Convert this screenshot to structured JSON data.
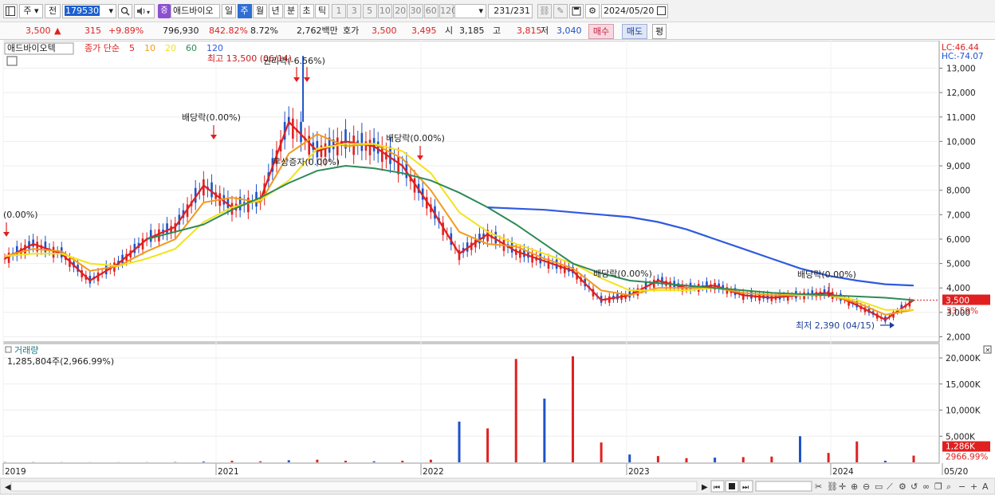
{
  "toolbar": {
    "type_label": "주",
    "compare_label": "전",
    "stock_code": "179530",
    "badge": "증",
    "stock_name": "애드바이오",
    "periods": [
      "일",
      "주",
      "월",
      "년",
      "분",
      "초",
      "틱"
    ],
    "active_period": "주",
    "intervals": [
      "1",
      "3",
      "5",
      "10",
      "20",
      "30",
      "60",
      "120"
    ],
    "count_value": "231",
    "count_total": "/231",
    "date": "2024/05/20"
  },
  "info": {
    "price": "3,500",
    "arrow": "▲",
    "change": "315",
    "change_pct": "+9.89%",
    "volume": "796,930",
    "volume_ratio": "842.82%",
    "turnover": "8.72%",
    "amount": "2,762백만",
    "quote_label": "호가",
    "ask": "3,500",
    "bid": "3,495",
    "open_label": "시",
    "open": "3,185",
    "high_label": "고",
    "high": "3,815",
    "low_label": "저",
    "low": "3,040",
    "buy_label": "매수",
    "sell_label": "매도",
    "eval_label": "평"
  },
  "price_panel": {
    "stock_label": "애드바이오텍",
    "ma_title": "종가 단순",
    "ma_periods": [
      "5",
      "10",
      "20",
      "60",
      "120"
    ],
    "ma_colors": [
      "#e02020",
      "#f29a1c",
      "#f2e31c",
      "#2e8a57",
      "#2f5ae0"
    ],
    "lc_label": "LC:46.44",
    "hc_label": "HC:-74.07",
    "y_ticks": [
      "13,000",
      "12,000",
      "11,000",
      "10,000",
      "9,000",
      "8,000",
      "7,000",
      "6,000",
      "5,000",
      "4,000",
      "3,000",
      "2,000"
    ],
    "current_price_badge": "3,500",
    "current_pct": "33.59%",
    "annotations": {
      "high": "최고 13,500 (06/14)",
      "rights": "권리락(-6.56%)",
      "div_2021": "배당락(0.00%)",
      "bonus": "무상증자(0.00%)",
      "div_2022": "배당락(0.00%)",
      "left": "(0.00%)",
      "div_2023a": "배당락(0.00%)",
      "div_2023b": "배당락(0.00%)",
      "low": "최저 2,390 (04/15)"
    }
  },
  "volume_panel": {
    "title": "거래량",
    "value_label": "1,285,804주(2,966.99%)",
    "y_ticks": [
      "20,000K",
      "15,000K",
      "10,000K",
      "5,000K"
    ],
    "current_badge": "1,286K",
    "current_pct": "2966.99%"
  },
  "x_axis": {
    "labels": [
      "2019",
      "2021",
      "2022",
      "2023",
      "2024",
      "05/20"
    ]
  },
  "chart_data": {
    "type": "candlestick",
    "title": "애드바이오텍",
    "period": "weekly",
    "x": [
      "2019",
      "2021",
      "2022",
      "2023",
      "2024",
      "05/20"
    ],
    "close_series": [
      {
        "name": "5",
        "values": [
          5200,
          5800,
          5400,
          4300,
          5000,
          6000,
          6500,
          8200,
          7300,
          7600,
          10800,
          9600,
          10000,
          9800,
          9000,
          7300,
          5400,
          6200,
          5500,
          5100,
          4700,
          3500,
          3700,
          4300,
          4000,
          4100,
          3700,
          3600,
          3700,
          3800,
          3300,
          2700,
          3500
        ]
      },
      {
        "name": "10",
        "values": [
          5300,
          5600,
          5500,
          4700,
          4900,
          5500,
          6000,
          7500,
          7700,
          7500,
          9500,
          10300,
          9800,
          9900,
          9300,
          8000,
          6300,
          5800,
          5700,
          5200,
          4800,
          3900,
          3700,
          4000,
          4000,
          4000,
          3800,
          3700,
          3700,
          3700,
          3400,
          2900,
          3100
        ]
      },
      {
        "name": "20",
        "values": [
          5300,
          5400,
          5400,
          5000,
          4900,
          5200,
          5600,
          6700,
          7300,
          7600,
          8400,
          9700,
          9900,
          9900,
          9600,
          8700,
          7100,
          6300,
          5800,
          5400,
          5000,
          4400,
          3900,
          3900,
          3900,
          4000,
          3900,
          3800,
          3700,
          3700,
          3500,
          3100,
          3100
        ]
      },
      {
        "name": "60",
        "values": [
          null,
          null,
          null,
          null,
          null,
          6000,
          6300,
          6600,
          7200,
          7700,
          8300,
          8800,
          9000,
          8900,
          8700,
          8400,
          7900,
          7300,
          6600,
          5800,
          5000,
          4600,
          4300,
          4200,
          4100,
          4000,
          3900,
          3800,
          3750,
          3700,
          3650,
          3600,
          3500
        ]
      },
      {
        "name": "120",
        "values": [
          null,
          null,
          null,
          null,
          null,
          null,
          null,
          null,
          null,
          null,
          null,
          null,
          null,
          null,
          null,
          null,
          null,
          7300,
          7250,
          7200,
          7100,
          7000,
          6900,
          6700,
          6400,
          6000,
          5600,
          5200,
          4800,
          4500,
          4300,
          4150,
          4100
        ]
      }
    ],
    "volume_k": [
      50,
      40,
      30,
      20,
      20,
      30,
      60,
      150,
      300,
      200,
      400,
      500,
      300,
      200,
      300,
      500,
      7800,
      6500,
      19800,
      12200,
      20300,
      3800,
      1500,
      1200,
      800,
      900,
      1000,
      1100,
      5000,
      1800,
      4000,
      300,
      1286
    ],
    "ylim": [
      2000,
      13500
    ],
    "volume_ylim": [
      0,
      21000
    ],
    "high": 13500,
    "low": 2390,
    "last_close": 3500
  }
}
